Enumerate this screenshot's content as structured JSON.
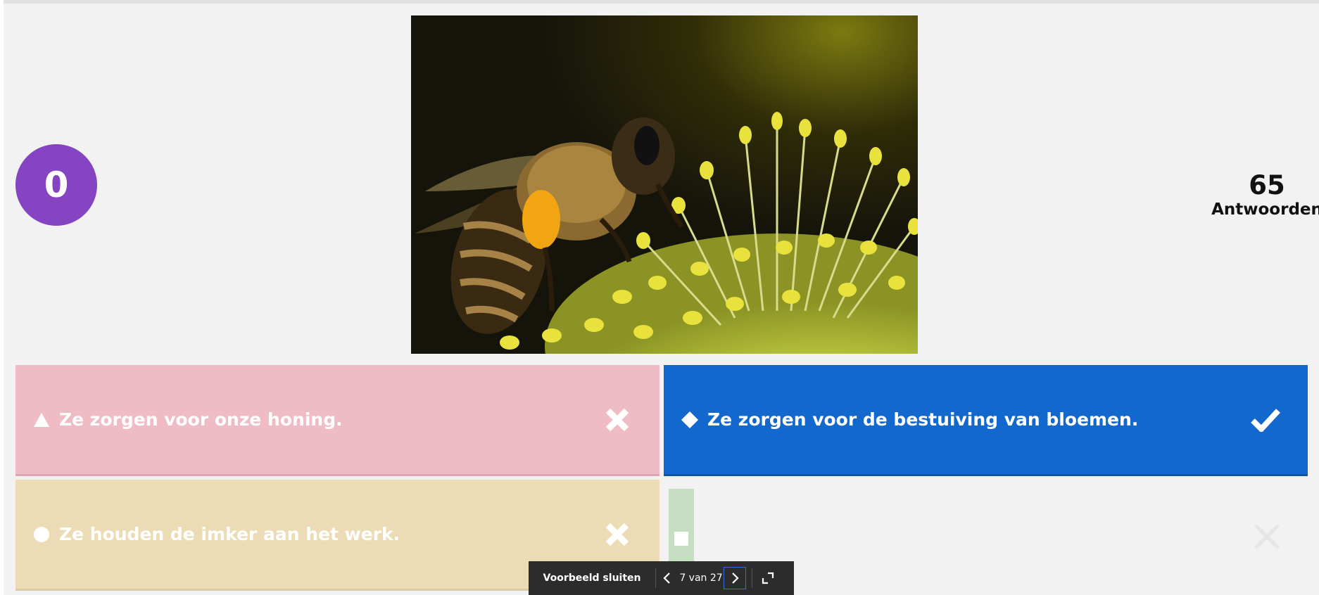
{
  "timer": {
    "value": "0",
    "color": "#8544c1"
  },
  "answer_count": {
    "value": "65",
    "label": "Antwoorden"
  },
  "question_image": {
    "subject": "bee-on-flower-photo"
  },
  "answers": [
    {
      "text": "Ze zorgen voor onze honing.",
      "shape": "triangle-icon",
      "correct": false,
      "color": "#efbcc6"
    },
    {
      "text": "Ze zorgen voor de bestuiving van bloemen.",
      "shape": "diamond-icon",
      "correct": true,
      "color": "#1368ce"
    },
    {
      "text": "Ze houden de imker aan het werk.",
      "shape": "circle-icon",
      "correct": false,
      "color": "#ecdcb5"
    },
    {
      "text": "",
      "shape": "square-icon",
      "correct": false,
      "color": "#c6dec1"
    }
  ],
  "toolbar": {
    "close_label": "Voorbeeld sluiten",
    "counter": "7 van 27"
  }
}
